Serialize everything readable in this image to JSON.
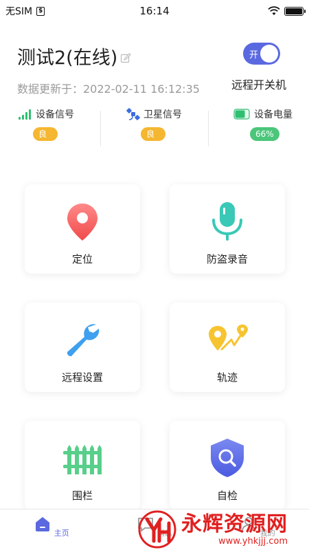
{
  "status_bar": {
    "carrier": "无SIM",
    "time": "16:14",
    "battery_level": 1.0
  },
  "device": {
    "title": "测试2(在线)",
    "update_time": "数据更新于：2022-02-11 16:12:35",
    "power_toggle_label": "开",
    "power_label": "远程开关机"
  },
  "signals": [
    {
      "label": "设备信号",
      "value": "良",
      "icon": "signal-bars-icon",
      "color": "#f5b731"
    },
    {
      "label": "卫星信号",
      "value": "良",
      "icon": "satellite-icon",
      "color": "#f5b731"
    },
    {
      "label": "设备电量",
      "value": "66%",
      "icon": "battery-icon",
      "color": "#4bc67a"
    }
  ],
  "features": [
    {
      "label": "定位",
      "icon": "location-pin-icon"
    },
    {
      "label": "防盗录音",
      "icon": "microphone-icon"
    },
    {
      "label": "远程设置",
      "icon": "wrench-icon"
    },
    {
      "label": "轨迹",
      "icon": "route-track-icon"
    },
    {
      "label": "围栏",
      "icon": "fence-icon"
    },
    {
      "label": "自检",
      "icon": "shield-search-icon"
    }
  ],
  "tabs": [
    {
      "label": "主页",
      "icon": "home-icon",
      "active": true
    },
    {
      "label": "消息",
      "icon": "message-icon",
      "active": false
    },
    {
      "label": "我的",
      "icon": "profile-icon",
      "active": false
    }
  ],
  "watermark": {
    "title": "永辉资源网",
    "url": "www.yhkjjj.com"
  },
  "colors": {
    "accent": "#5b69e0",
    "badge_good": "#f5b731",
    "badge_battery": "#4bc67a"
  }
}
